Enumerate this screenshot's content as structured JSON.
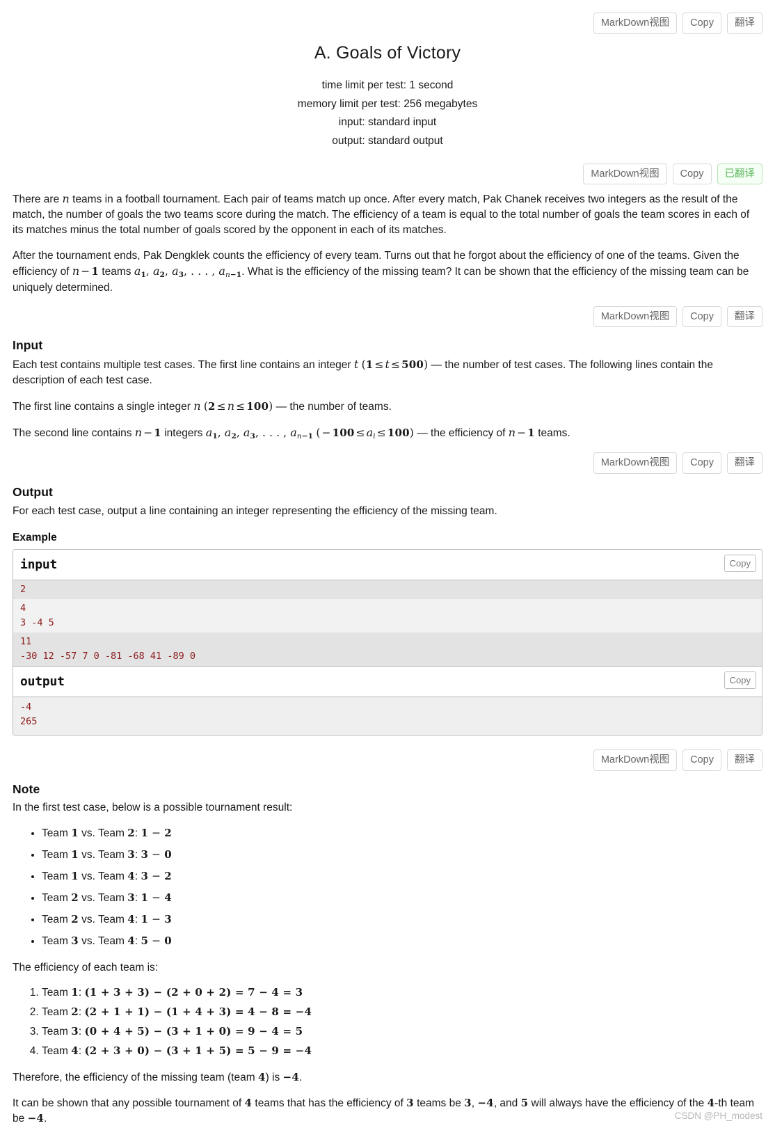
{
  "toolbars": {
    "markdown_label": "MarkDown视图",
    "copy_label": "Copy",
    "translate_label": "翻译",
    "translated_label": "已翻译"
  },
  "problem": {
    "title": "A. Goals of Victory",
    "limits": [
      "time limit per test: 1 second",
      "memory limit per test: 256 megabytes",
      "input: standard input",
      "output: standard output"
    ]
  },
  "statement": {
    "p1_a": "There are ",
    "p1_n": "n",
    "p1_b": " teams in a football tournament. Each pair of teams match up once. After every match, Pak Chanek receives two integers as the result of the match, the number of goals the two teams score during the match. The efficiency of a team is equal to the total number of goals the team scores in each of its matches minus the total number of goals scored by the opponent in each of its matches.",
    "p2_a": "After the tournament ends, Pak Dengklek counts the efficiency of every team. Turns out that he forgot about the efficiency of one of the teams. Given the efficiency of ",
    "p2_nm1": "n − 1",
    "p2_b": " teams ",
    "p2_seq": "a₁, a₂, a₃, …, aₙ₋₁",
    "p2_c": ". What is the efficiency of the missing team? It can be shown that the efficiency of the missing team can be uniquely determined."
  },
  "input_section": {
    "heading": "Input",
    "l1_a": "Each test contains multiple test cases. The first line contains an integer ",
    "l1_t": "t",
    "l1_range": "(1 ≤ t ≤ 500)",
    "l1_b": " — the number of test cases. The following lines contain the description of each test case.",
    "l2_a": "The first line contains a single integer ",
    "l2_n": "n",
    "l2_range": "(2 ≤ n ≤ 100)",
    "l2_b": " — the number of teams.",
    "l3_a": "The second line contains ",
    "l3_nm1": "n − 1",
    "l3_b": " integers ",
    "l3_seq": "a₁, a₂, a₃, …, aₙ₋₁",
    "l3_range": "(−100 ≤ aᵢ ≤ 100)",
    "l3_c": " — the efficiency of ",
    "l3_nm1b": "n − 1",
    "l3_d": " teams."
  },
  "output_section": {
    "heading": "Output",
    "text": "For each test case, output a line containing an integer representing the efficiency of the missing team."
  },
  "example": {
    "heading": "Example",
    "input_label": "input",
    "output_label": "output",
    "copy_label": "Copy",
    "input_groups": [
      {
        "shaded": true,
        "lines": [
          "2"
        ]
      },
      {
        "shaded": false,
        "lines": [
          "4",
          "3 -4 5"
        ]
      },
      {
        "shaded": true,
        "lines": [
          "11",
          "-30 12 -57 7 0 -81 -68 41 -89 0"
        ]
      }
    ],
    "output_lines": [
      "-4",
      "265"
    ]
  },
  "note_section": {
    "heading": "Note",
    "intro": "In the first test case, below is a possible tournament result:",
    "matches": [
      {
        "prefix": "Team ",
        "t1": "1",
        "mid": " vs. Team ",
        "t2": "2",
        "colon": ": ",
        "s1": "1",
        "dash": " − ",
        "s2": "2"
      },
      {
        "prefix": "Team ",
        "t1": "1",
        "mid": " vs. Team ",
        "t2": "3",
        "colon": ": ",
        "s1": "3",
        "dash": " − ",
        "s2": "0"
      },
      {
        "prefix": "Team ",
        "t1": "1",
        "mid": " vs. Team ",
        "t2": "4",
        "colon": ": ",
        "s1": "3",
        "dash": " − ",
        "s2": "2"
      },
      {
        "prefix": "Team ",
        "t1": "2",
        "mid": " vs. Team ",
        "t2": "3",
        "colon": ": ",
        "s1": "1",
        "dash": " − ",
        "s2": "4"
      },
      {
        "prefix": "Team ",
        "t1": "2",
        "mid": " vs. Team ",
        "t2": "4",
        "colon": ": ",
        "s1": "1",
        "dash": " − ",
        "s2": "3"
      },
      {
        "prefix": "Team ",
        "t1": "3",
        "mid": " vs. Team ",
        "t2": "4",
        "colon": ": ",
        "s1": "5",
        "dash": " − ",
        "s2": "0"
      }
    ],
    "eff_intro": "The efficiency of each team is:",
    "efficiencies": [
      {
        "label": "Team ",
        "team": "1",
        "colon": ": ",
        "expr": "(1 + 3 + 3) − (2 + 0 + 2) = 7 − 4 = 3"
      },
      {
        "label": "Team ",
        "team": "2",
        "colon": ": ",
        "expr": "(2 + 1 + 1) − (1 + 4 + 3) = 4 − 8 = −4"
      },
      {
        "label": "Team ",
        "team": "3",
        "colon": ": ",
        "expr": "(0 + 4 + 5) − (3 + 1 + 0) = 9 − 4 = 5"
      },
      {
        "label": "Team ",
        "team": "4",
        "colon": ": ",
        "expr": "(2 + 3 + 0) − (3 + 1 + 5) = 5 − 9 = −4"
      }
    ],
    "conclusion_a": "Therefore, the efficiency of the missing team (team ",
    "conclusion_team": "4",
    "conclusion_b": ") is ",
    "conclusion_val": "−4",
    "conclusion_c": ".",
    "final_a": "It can be shown that any possible tournament of ",
    "final_n1": "4",
    "final_b": " teams that has the efficiency of ",
    "final_n2": "3",
    "final_c": " teams be ",
    "final_v1": "3",
    "final_d": ", ",
    "final_v2": "−4",
    "final_e": ", and ",
    "final_v3": "5",
    "final_f": " will always have the efficiency of the ",
    "final_n3": "4",
    "final_g": "-th team be ",
    "final_v4": "−4",
    "final_h": "."
  },
  "watermark": "CSDN @PH_modest"
}
